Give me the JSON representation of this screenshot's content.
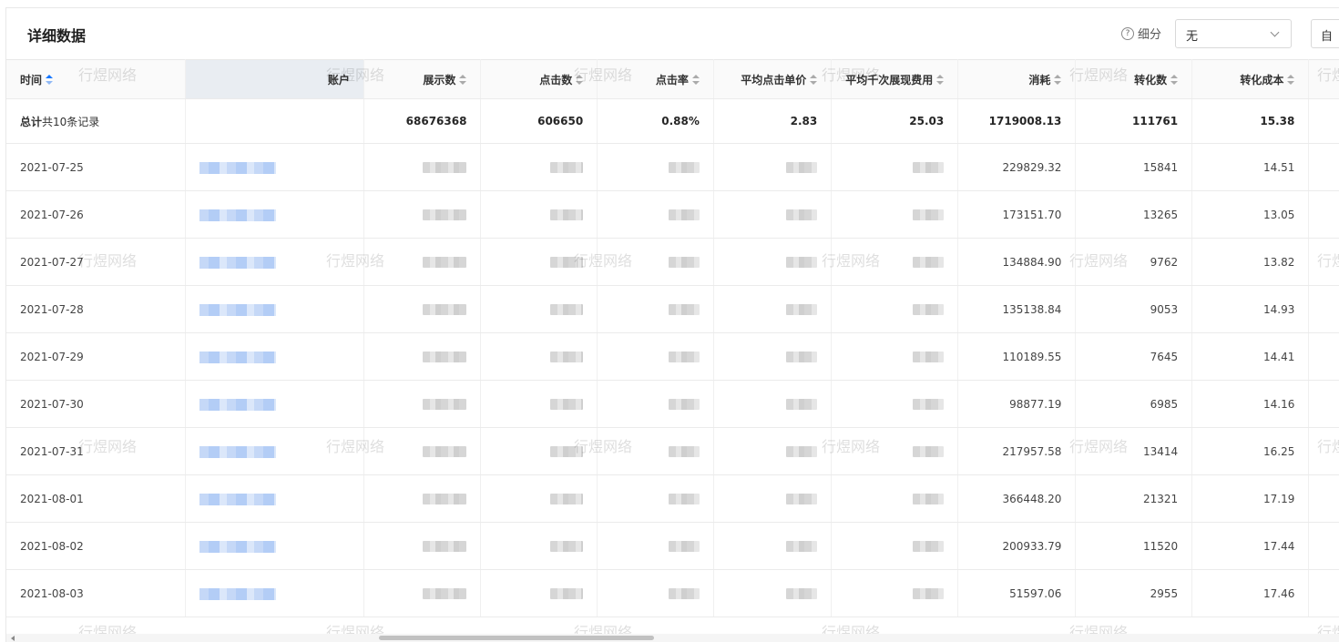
{
  "panel": {
    "title": "详细数据",
    "breakdown_label": "细分",
    "breakdown_value": "无",
    "custom_button": "自"
  },
  "table": {
    "columns": [
      {
        "key": "date",
        "label": "时间",
        "sortable": true,
        "active": true
      },
      {
        "key": "account",
        "label": "账户",
        "sortable": false
      },
      {
        "key": "impressions",
        "label": "展示数",
        "sortable": true
      },
      {
        "key": "clicks",
        "label": "点击数",
        "sortable": true
      },
      {
        "key": "ctr",
        "label": "点击率",
        "sortable": true
      },
      {
        "key": "cpc",
        "label": "平均点击单价",
        "sortable": true
      },
      {
        "key": "cpm",
        "label": "平均千次展现费用",
        "sortable": true
      },
      {
        "key": "spend",
        "label": "消耗",
        "sortable": true
      },
      {
        "key": "conversions",
        "label": "转化数",
        "sortable": true
      },
      {
        "key": "cpa",
        "label": "转化成本",
        "sortable": true
      }
    ],
    "total": {
      "label_prefix": "总计",
      "label_suffix": "共10条记录",
      "impressions": "68676368",
      "clicks": "606650",
      "ctr": "0.88%",
      "cpc": "2.83",
      "cpm": "25.03",
      "spend": "1719008.13",
      "conversions": "111761",
      "cpa": "15.38"
    },
    "rows": [
      {
        "date": "2021-07-25",
        "spend": "229829.32",
        "conversions": "15841",
        "cpa": "14.51"
      },
      {
        "date": "2021-07-26",
        "spend": "173151.70",
        "conversions": "13265",
        "cpa": "13.05"
      },
      {
        "date": "2021-07-27",
        "spend": "134884.90",
        "conversions": "9762",
        "cpa": "13.82"
      },
      {
        "date": "2021-07-28",
        "spend": "135138.84",
        "conversions": "9053",
        "cpa": "14.93"
      },
      {
        "date": "2021-07-29",
        "spend": "110189.55",
        "conversions": "7645",
        "cpa": "14.41"
      },
      {
        "date": "2021-07-30",
        "spend": "98877.19",
        "conversions": "6985",
        "cpa": "14.16"
      },
      {
        "date": "2021-07-31",
        "spend": "217957.58",
        "conversions": "13414",
        "cpa": "16.25"
      },
      {
        "date": "2021-08-01",
        "spend": "366448.20",
        "conversions": "21321",
        "cpa": "17.19"
      },
      {
        "date": "2021-08-02",
        "spend": "200933.79",
        "conversions": "11520",
        "cpa": "17.44"
      },
      {
        "date": "2021-08-03",
        "spend": "51597.06",
        "conversions": "2955",
        "cpa": "17.46"
      }
    ]
  },
  "watermark": {
    "text": "行煜网络"
  },
  "colors": {
    "accent": "#1677ff",
    "header_bg": "#fafafa",
    "account_header_bg": "#e9edf2"
  }
}
